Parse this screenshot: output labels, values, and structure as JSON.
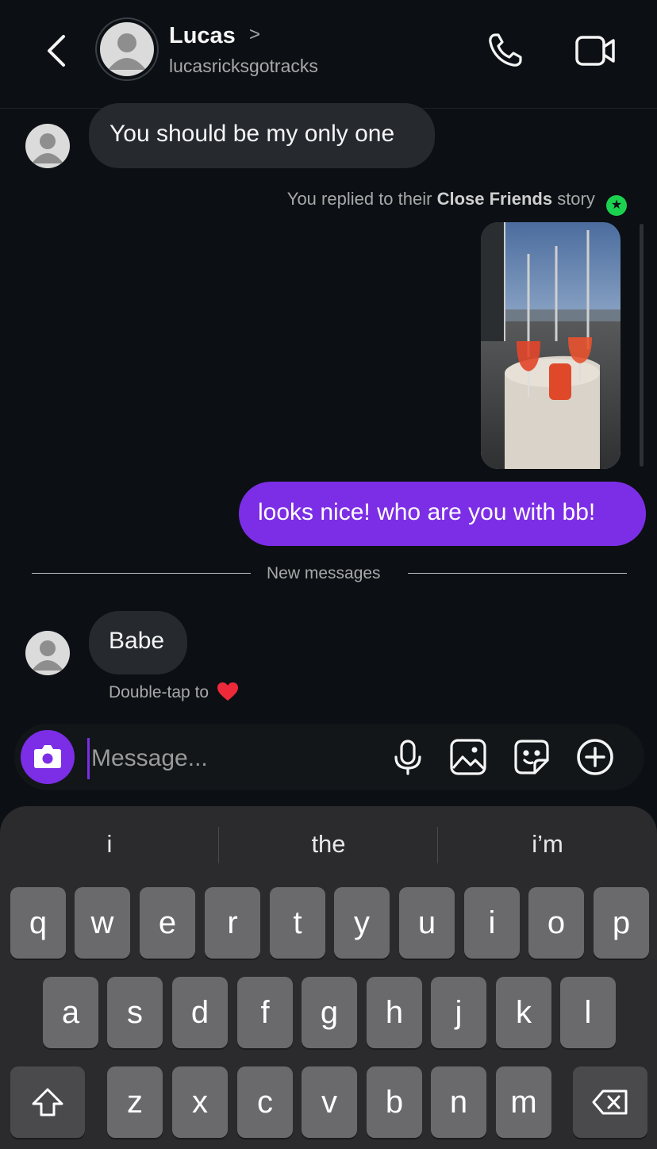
{
  "header": {
    "name": "Lucas",
    "chevron": ">",
    "username": "lucasricksgotracks"
  },
  "messages": {
    "first_incoming": "You should be my only one",
    "reply_note_prefix": "You replied to their",
    "reply_note_bold": "Close Friends",
    "reply_note_suffix": "story",
    "outgoing": "looks nice! who are you with bb!",
    "new_messages_label": "New messages",
    "second_incoming": "Babe",
    "double_tap_label": "Double-tap to"
  },
  "composer": {
    "placeholder": "Message..."
  },
  "keyboard": {
    "suggestions": [
      "i",
      "the",
      "i’m"
    ],
    "row1": [
      "q",
      "w",
      "e",
      "r",
      "t",
      "y",
      "u",
      "i",
      "o",
      "p"
    ],
    "row2": [
      "a",
      "s",
      "d",
      "f",
      "g",
      "h",
      "j",
      "k",
      "l"
    ],
    "row3": [
      "z",
      "x",
      "c",
      "v",
      "b",
      "n",
      "m"
    ]
  },
  "colors": {
    "background": "#0c1014",
    "accent": "#7c2ee6",
    "incoming_bubble": "#262a2f",
    "close_friends_badge": "#1cd14f"
  },
  "icons": {
    "back": "chevron-left-icon",
    "call": "phone-icon",
    "video": "video-camera-icon",
    "camera": "camera-icon",
    "mic": "microphone-icon",
    "gallery": "image-icon",
    "sticker": "sticker-icon",
    "more": "plus-circle-icon",
    "shift": "shift-icon",
    "delete": "backspace-icon",
    "heart": "heart-icon"
  }
}
